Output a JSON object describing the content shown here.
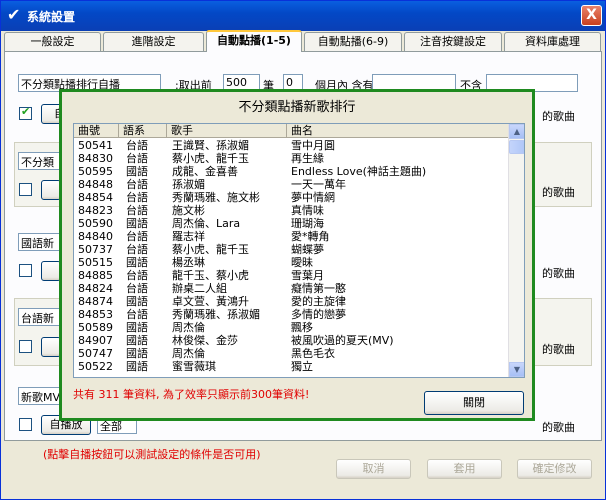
{
  "window": {
    "title": "系統設置",
    "close_label": "X"
  },
  "tabs": [
    "一般設定",
    "進階設定",
    "自動點播(1-5)",
    "自動點播(6-9)",
    "注音按鍵設定",
    "資料庫處理"
  ],
  "background": {
    "row1": {
      "name": "不分類點播排行自播",
      "take_label": ":取出前",
      "take_value": "500",
      "unit_label": "筆",
      "zero_value": "0",
      "months_label": "個月內 含有",
      "exclude_label": "不含"
    },
    "row1_sub": {
      "auto_label": "自",
      "songs_label": "的歌曲"
    },
    "row2": {
      "name": "不分類",
      "songs_label": "的歌曲"
    },
    "row3": {
      "name": "國語新",
      "songs_label": "的歌曲"
    },
    "row4": {
      "name": "台語新",
      "songs_label": "的歌曲"
    },
    "row5": {
      "name": "新歌MV",
      "auto_label": "自播放",
      "field_value": "全部",
      "songs_label": "的歌曲"
    },
    "hint": "(點擊自播按鈕可以測試設定的條件是否可用)",
    "buttons": {
      "cancel": "取消",
      "apply": "套用",
      "confirm": "確定修改"
    }
  },
  "dialog": {
    "title": "不分類點播新歌排行",
    "columns": [
      "曲號",
      "語系",
      "歌手",
      "曲名"
    ],
    "rows": [
      [
        "50541",
        "台語",
        "王識賢、孫淑媚",
        "雪中月圓"
      ],
      [
        "84830",
        "台語",
        "蔡小虎、龍千玉",
        "再生緣"
      ],
      [
        "50595",
        "國語",
        "成龍、金喜善",
        "Endless Love(神話主題曲)"
      ],
      [
        "84848",
        "台語",
        "孫淑媚",
        "一天一萬年"
      ],
      [
        "84854",
        "台語",
        "秀蘭瑪雅、施文彬",
        "夢中情網"
      ],
      [
        "84823",
        "台語",
        "施文彬",
        "真情味"
      ],
      [
        "50590",
        "國語",
        "周杰倫、Lara",
        "珊瑚海"
      ],
      [
        "84840",
        "台語",
        "羅志祥",
        "愛*轉角"
      ],
      [
        "50737",
        "台語",
        "蔡小虎、龍千玉",
        "蝴蝶夢"
      ],
      [
        "50515",
        "國語",
        "楊丞琳",
        "曖昧"
      ],
      [
        "84885",
        "台語",
        "龍千玉、蔡小虎",
        "雪葉月"
      ],
      [
        "84824",
        "台語",
        "辦桌二人組",
        "癡情第一憨"
      ],
      [
        "84874",
        "國語",
        "卓文萱、黃鴻升",
        "愛的主旋律"
      ],
      [
        "84853",
        "台語",
        "秀蘭瑪雅、孫淑媚",
        "多情的戀夢"
      ],
      [
        "50589",
        "國語",
        "周杰倫",
        "飄移"
      ],
      [
        "84907",
        "國語",
        "林俊傑、金莎",
        "被風吹過的夏天(MV)"
      ],
      [
        "50747",
        "國語",
        "周杰倫",
        "黑色毛衣"
      ],
      [
        "50522",
        "國語",
        "蜜雪薇琪",
        "獨立"
      ]
    ],
    "status": "共有 311 筆資料, 為了效率只顯示前300筆資料!",
    "close_button": "關閉"
  }
}
